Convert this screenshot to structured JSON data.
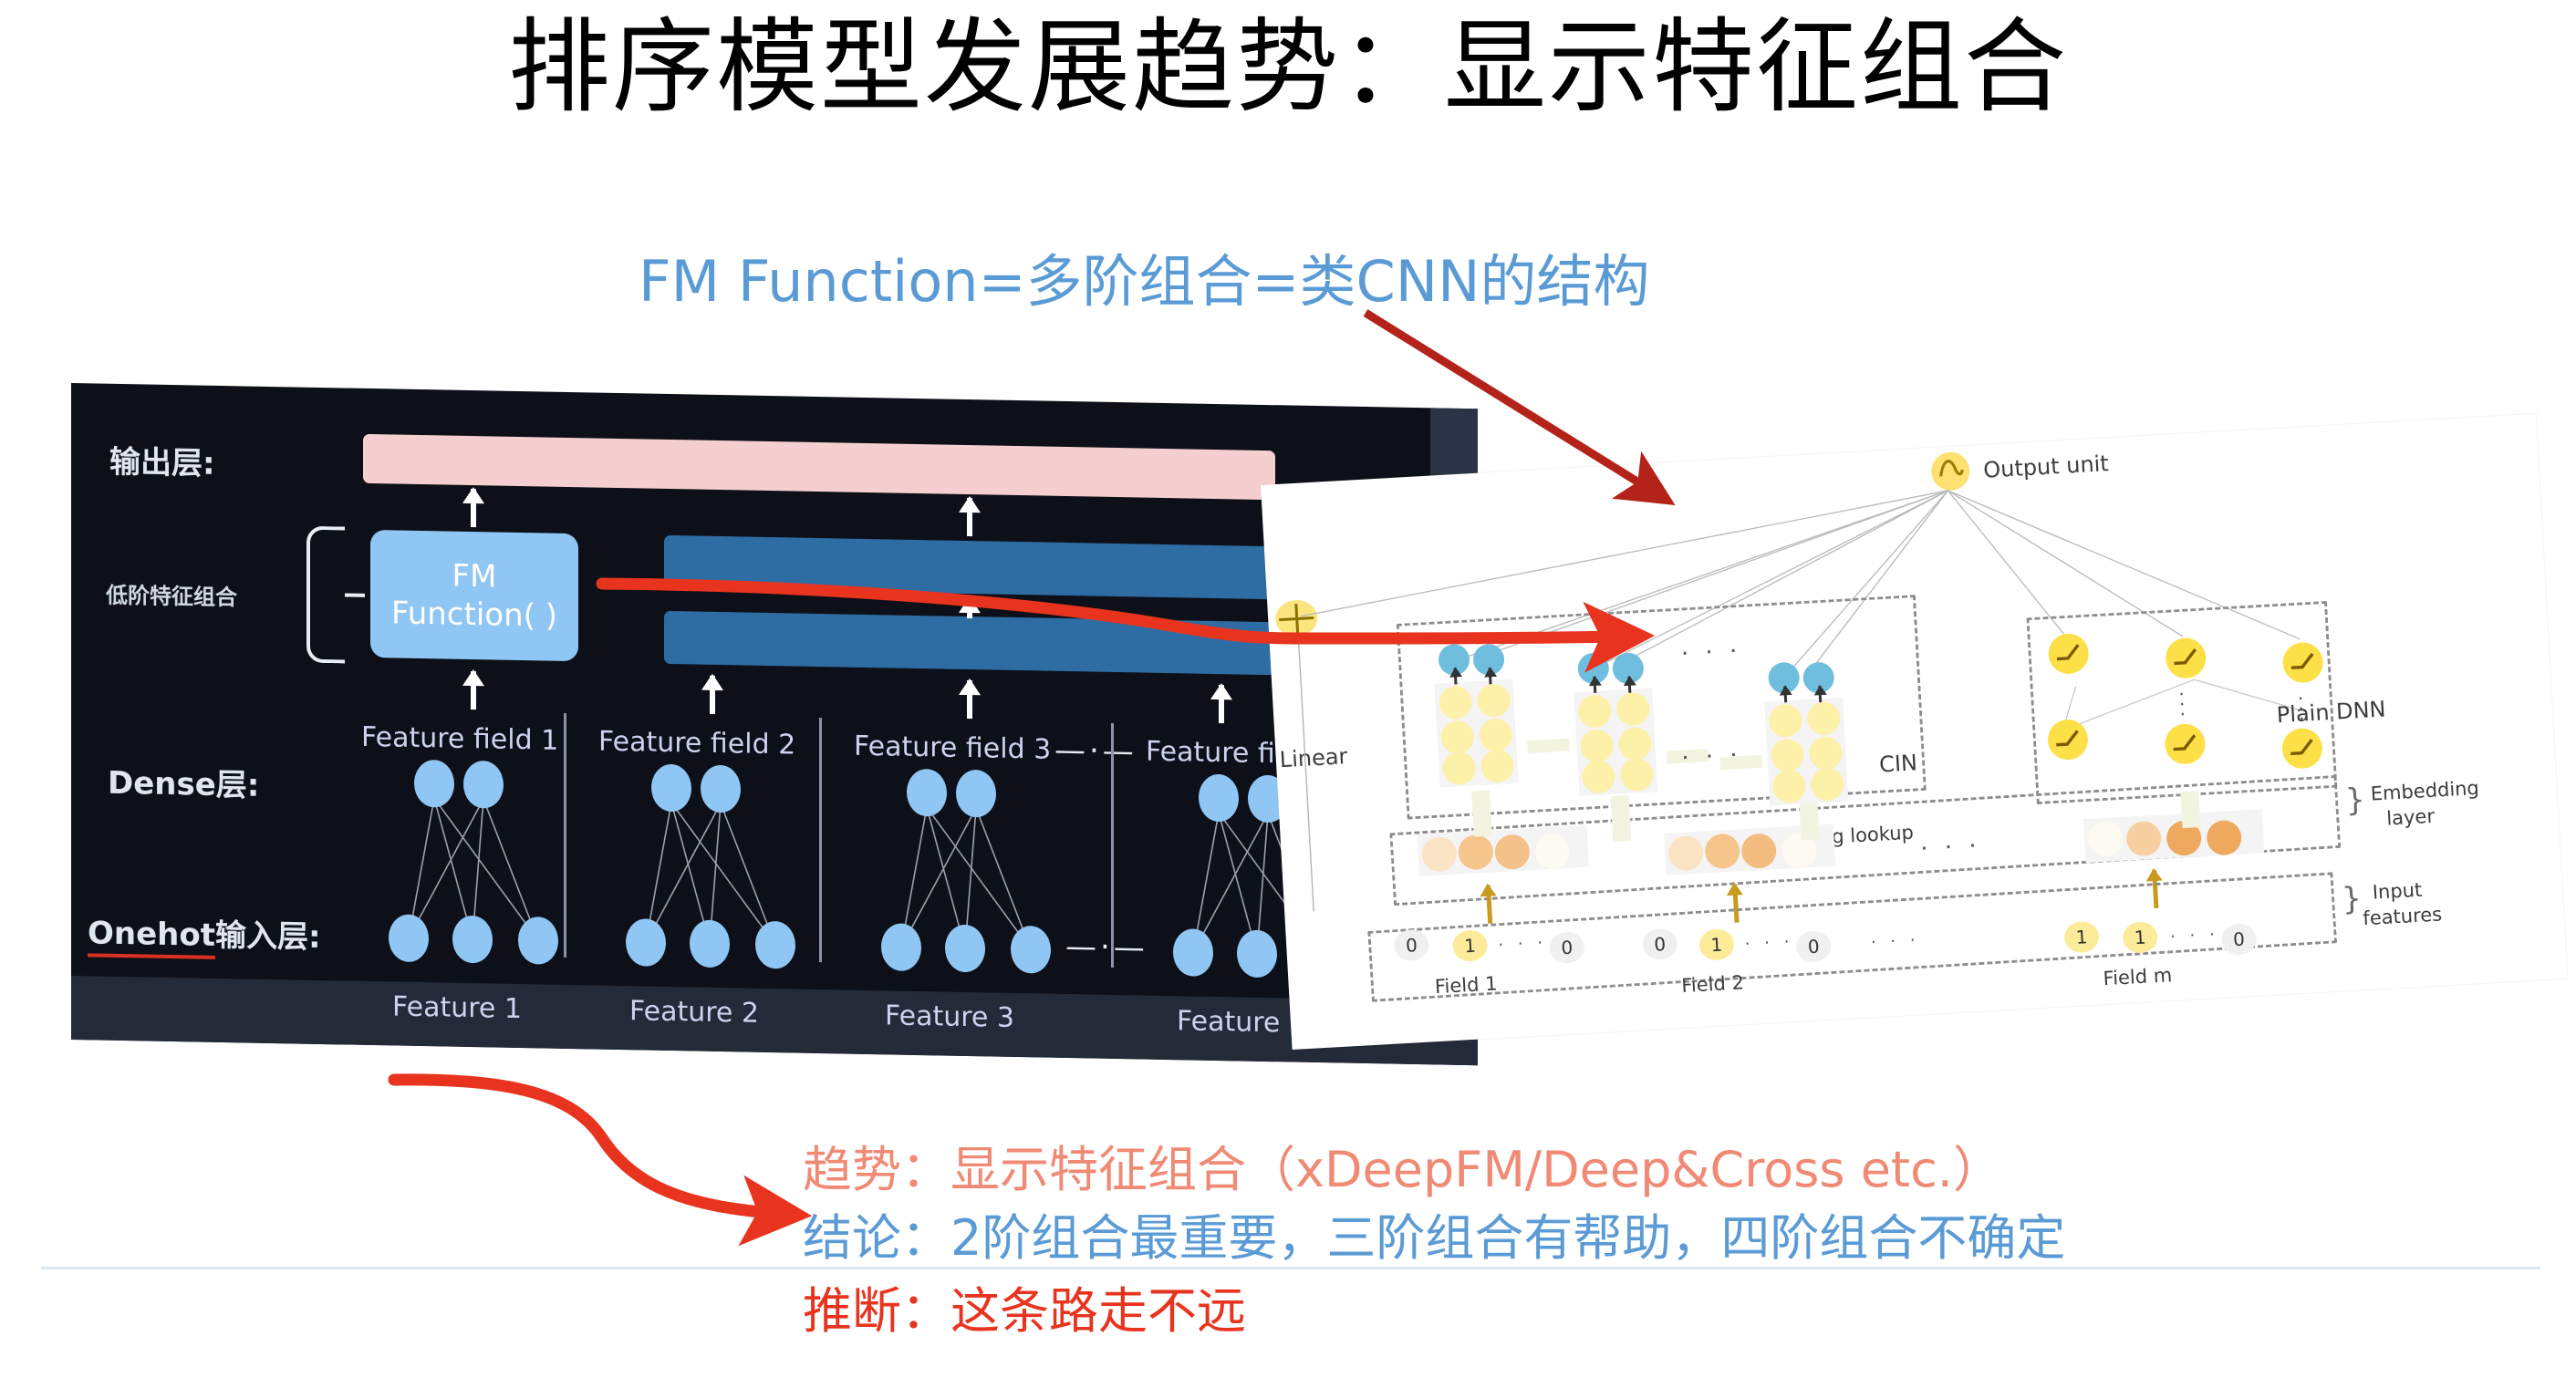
{
  "slide": {
    "title": "排序模型发展趋势：显示特征组合",
    "callout_blue": "FM Function=多阶组合=类CNN的结构"
  },
  "colors": {
    "title": "#000000",
    "callout_blue": "#5b9bd5",
    "trend_salmon": "#f08a74",
    "conclusion_blue": "#5b9bd5",
    "inference_red": "#e8341f",
    "dark_panel_bg": "#0d1018",
    "output_bar_pink": "#f5cfcf",
    "fm_box_blue": "#8fc6f3",
    "hidden_bar_blue": "#2e6ca4",
    "node_blue": "#8fc6f3",
    "red_arrow": "#e8341f",
    "dark_red_arrow": "#b32319",
    "cin_yellow": "#fdf0a8",
    "cin_blue": "#6fbedd",
    "embedding_orange": "#f0a95c",
    "relu_yellow": "#fde047"
  },
  "left_diagram": {
    "layer_labels": {
      "output": "输出层:",
      "dense": "Dense层:",
      "onehot_prefix": "Onehot",
      "onehot_suffix": "输入层:",
      "low_order": "低阶特征组合"
    },
    "fm_box": {
      "line1": "FM",
      "line2": "Function( )"
    },
    "field_labels": [
      "Feature field 1",
      "Feature field 2",
      "Feature field 3",
      "Feature field N"
    ],
    "feature_labels": [
      "Feature 1",
      "Feature 2",
      "Feature 3",
      "Feature N"
    ],
    "ellipsis": "—·—"
  },
  "right_diagram": {
    "labels": {
      "output_unit": "Output unit",
      "linear": "Linear",
      "cin": "CIN",
      "plain_dnn": "Plain DNN",
      "embedding_lookup": "Embedding lookup",
      "embedding_layer_l1": "Embedding",
      "embedding_layer_l2": "layer",
      "input_features_l1": "Input",
      "input_features_l2": "features"
    },
    "fields": [
      "Field 1",
      "Field 2",
      "Field m"
    ],
    "field_bits": {
      "field_1": [
        "0",
        "1",
        "0"
      ],
      "field_2": [
        "0",
        "1",
        "0"
      ],
      "field_m": [
        "1",
        "1",
        "0"
      ]
    },
    "ellipsis": "· · ·"
  },
  "bottom_notes": {
    "trend": "趋势：显示特征组合（xDeepFM/Deep&Cross etc.）",
    "conclusion": "结论：2阶组合最重要，三阶组合有帮助，四阶组合不确定",
    "inference": "推断：这条路走不远"
  }
}
